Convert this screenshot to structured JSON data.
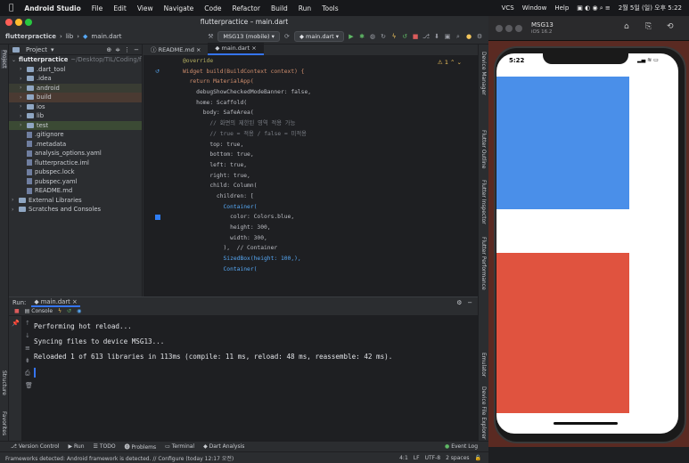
{
  "menubar": {
    "app": "Android Studio",
    "items": [
      "File",
      "Edit",
      "View",
      "Navigate",
      "Code",
      "Refactor",
      "Build",
      "Run",
      "Tools"
    ],
    "right_items": [
      "VCS",
      "Window",
      "Help"
    ],
    "clock": "2월 5일 (일) 오후 5:22"
  },
  "ide": {
    "window_title": "flutterpractice – main.dart",
    "breadcrumb": [
      "flutterpractice",
      "lib",
      "main.dart"
    ],
    "device_selector": "MSG13 (mobile)",
    "run_config": "main.dart",
    "project_panel_label": "Project",
    "project_root": "flutterpractice",
    "project_root_path": "~/Desktop/TIL/Coding/fl",
    "tree": [
      {
        "name": ".dart_tool",
        "type": "folder",
        "depth": 1,
        "arrow": "›"
      },
      {
        "name": ".idea",
        "type": "folder",
        "depth": 1,
        "arrow": "›"
      },
      {
        "name": "android",
        "type": "folder",
        "depth": 1,
        "arrow": "›"
      },
      {
        "name": "build",
        "type": "folder",
        "depth": 1,
        "arrow": "›"
      },
      {
        "name": "ios",
        "type": "folder",
        "depth": 1,
        "arrow": "›"
      },
      {
        "name": "lib",
        "type": "folder",
        "depth": 1,
        "arrow": "›"
      },
      {
        "name": "test",
        "type": "folder",
        "depth": 1,
        "arrow": "›"
      },
      {
        "name": ".gitignore",
        "type": "file",
        "depth": 1,
        "arrow": ""
      },
      {
        "name": ".metadata",
        "type": "file",
        "depth": 1,
        "arrow": ""
      },
      {
        "name": "analysis_options.yaml",
        "type": "file",
        "depth": 1,
        "arrow": ""
      },
      {
        "name": "flutterpractice.iml",
        "type": "file",
        "depth": 1,
        "arrow": ""
      },
      {
        "name": "pubspec.lock",
        "type": "file",
        "depth": 1,
        "arrow": ""
      },
      {
        "name": "pubspec.yaml",
        "type": "file",
        "depth": 1,
        "arrow": ""
      },
      {
        "name": "README.md",
        "type": "file",
        "depth": 1,
        "arrow": ""
      },
      {
        "name": "External Libraries",
        "type": "folder",
        "depth": 0,
        "arrow": "›"
      },
      {
        "name": "Scratches and Consoles",
        "type": "folder",
        "depth": 0,
        "arrow": "›"
      }
    ],
    "tabs": [
      "README.md",
      "main.dart"
    ],
    "active_tab": 1,
    "warning_count": "1",
    "code_lines": [
      "@override",
      "Widget build(BuildContext context) {",
      "  return MaterialApp(",
      "    debugShowCheckedModeBanner: false,",
      "    home: Scaffold(",
      "      body: SafeArea(",
      "        // 화면의 제한된 영역 적용 가능",
      "        // true = 적용 / false = 미적용",
      "        top: true,",
      "        bottom: true,",
      "        left: true,",
      "        right: true,",
      "        child: Column(",
      "          children: [",
      "            Container(",
      "              color: Colors.blue,",
      "              height: 300,",
      "              width: 300,",
      "            ),  // Container",
      "            SizedBox(height: 100,),",
      "            Container("
    ],
    "right_tools": [
      "Device Manager",
      "Flutter Outline",
      "Flutter Inspector",
      "Flutter Performance",
      "Emulator",
      "Device File Explorer"
    ],
    "left_tools": [
      "Project",
      "Structure",
      "Favorites"
    ]
  },
  "run": {
    "label": "Run:",
    "config": "main.dart",
    "console_tab": "Console",
    "lines": [
      "Performing hot reload...",
      "Syncing files to device MSG13...",
      "Reloaded 1 of 613 libraries in 113ms (compile: 11 ms, reload: 48 ms, reassemble: 42 ms)."
    ]
  },
  "bottom_tools": [
    "Version Control",
    "Run",
    "TODO",
    "Problems",
    "Terminal",
    "Dart Analysis"
  ],
  "event_log": "Event Log",
  "status": {
    "message": "Frameworks detected: Android framework is detected. // Configure (today 12:17 오전)",
    "position": "4:1",
    "line_sep": "LF",
    "encoding": "UTF-8",
    "indent": "2 spaces"
  },
  "simulator": {
    "device_name": "MSG13",
    "os": "iOS 16.2",
    "time": "5:22",
    "colors": {
      "blue": "#4a8fe9",
      "red": "#e0533f"
    }
  }
}
